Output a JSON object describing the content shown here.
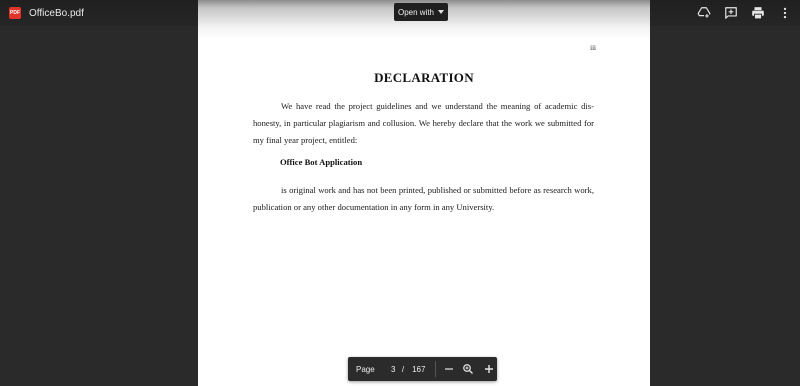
{
  "app": {
    "file_icon_text": "PDF",
    "filename": "OfficeBo.pdf"
  },
  "toolbar": {
    "open_with_label": "Open with",
    "actions": [
      "add-to-drive-icon",
      "add-comment-icon",
      "print-icon",
      "more-vert-icon"
    ]
  },
  "document": {
    "page_number": "iii",
    "title": "DECLARATION",
    "paragraph1": "We have read the project guidelines and we understand the meaning of academic dis-honesty, in particular plagiarism and collusion. We hereby declare that the work we submitted for my final year project, entitled:",
    "project_name": "Office Bot Application",
    "paragraph2": "is original work and has not been printed, published or submitted before as research work, publication or any other documentation in any form in any University."
  },
  "pager": {
    "label": "Page",
    "current": "3",
    "separator": "/",
    "total": "167"
  },
  "colors": {
    "background": "#2a2a2a",
    "toolbar": "#222222",
    "pdf_badge": "#e0342b",
    "page": "#ffffff"
  }
}
